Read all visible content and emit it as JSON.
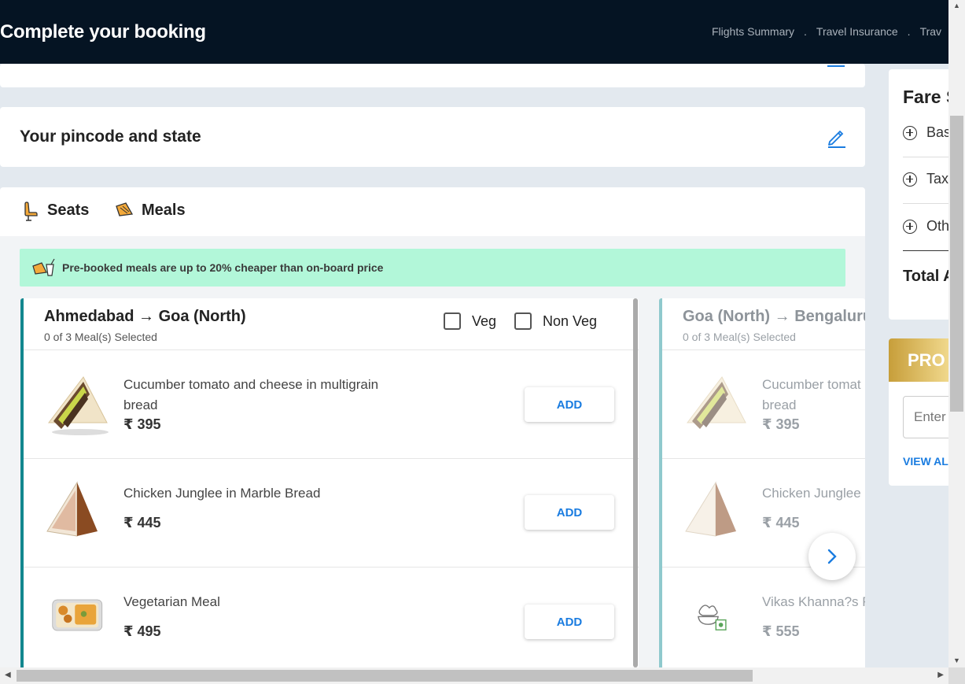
{
  "header": {
    "title": "Complete your booking",
    "steps": [
      "Flights Summary",
      "Travel Insurance",
      "Trav"
    ],
    "separator": "."
  },
  "pincode": {
    "heading": "Your pincode and state",
    "edit_icon": "pencil-icon"
  },
  "tabs": [
    {
      "label": "Seats",
      "icon": "seat-icon",
      "active": false
    },
    {
      "label": "Meals",
      "icon": "meal-icon",
      "active": true
    }
  ],
  "banner": {
    "text": "Pre-booked meals are up to 20% cheaper than on-board price",
    "icon": "meal-drink-icon",
    "color": "#b2f7d9"
  },
  "routes": [
    {
      "title": "Ahmedabad → Goa (North)",
      "subtitle": "0 of 3 Meal(s) Selected",
      "filters": {
        "veg": "Veg",
        "nonveg": "Non Veg"
      },
      "meals": [
        {
          "name": "Cucumber tomato and cheese in multigrain bread",
          "price": "₹ 395",
          "button": "ADD"
        },
        {
          "name": "Chicken Junglee in Marble Bread",
          "price": "₹ 445",
          "button": "ADD"
        },
        {
          "name": "Vegetarian Meal",
          "price": "₹ 495",
          "button": "ADD"
        }
      ]
    },
    {
      "title": "Goa (North) → Bengaluru",
      "subtitle": "0 of 3 Meal(s) Selected",
      "meals": [
        {
          "name": "Cucumber tomat",
          "name2": "bread",
          "price": "₹ 395"
        },
        {
          "name": "Chicken Junglee i",
          "price": "₹ 445"
        },
        {
          "name": "Vikas Khanna?s F",
          "price": "₹ 555"
        }
      ]
    }
  ],
  "fare": {
    "title": "Fare S",
    "items": [
      "Bas",
      "Tax",
      "Oth"
    ],
    "total": "Total A"
  },
  "promo": {
    "title": "PRO",
    "input_placeholder": "Enter",
    "link": "VIEW AL"
  },
  "colors": {
    "accent": "#1a7ce0",
    "header_bg": "#051423",
    "route_a": "#12878f",
    "route_b": "#8fc9cd"
  }
}
